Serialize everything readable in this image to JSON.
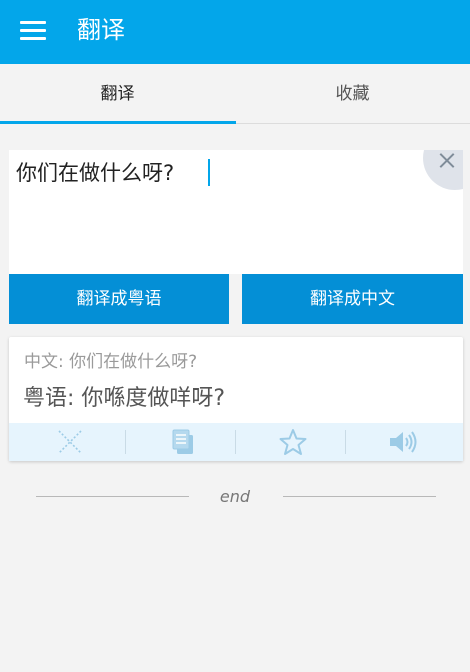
{
  "app": {
    "title": "翻译",
    "menu_icon": "hamburger-menu-icon"
  },
  "tabs": [
    {
      "label": "翻译",
      "active": true
    },
    {
      "label": "收藏",
      "active": false
    }
  ],
  "input": {
    "value": "你们在做什么呀?",
    "clear_icon": "close-icon"
  },
  "actions": {
    "to_cantonese": "翻译成粤语",
    "to_chinese": "翻译成中文"
  },
  "result": {
    "source_line": "中文: 你们在做什么呀?",
    "result_line": "粤语: 你喺度做咩呀?",
    "tools": [
      "delete-icon",
      "copy-icon",
      "star-icon",
      "speaker-icon"
    ]
  },
  "footer": {
    "end_label": "end"
  },
  "colors": {
    "primary": "#03a6ea",
    "button": "#048fd6",
    "toolbar_bg": "#e6f4fd",
    "tool_icon": "#9ccbe6"
  }
}
